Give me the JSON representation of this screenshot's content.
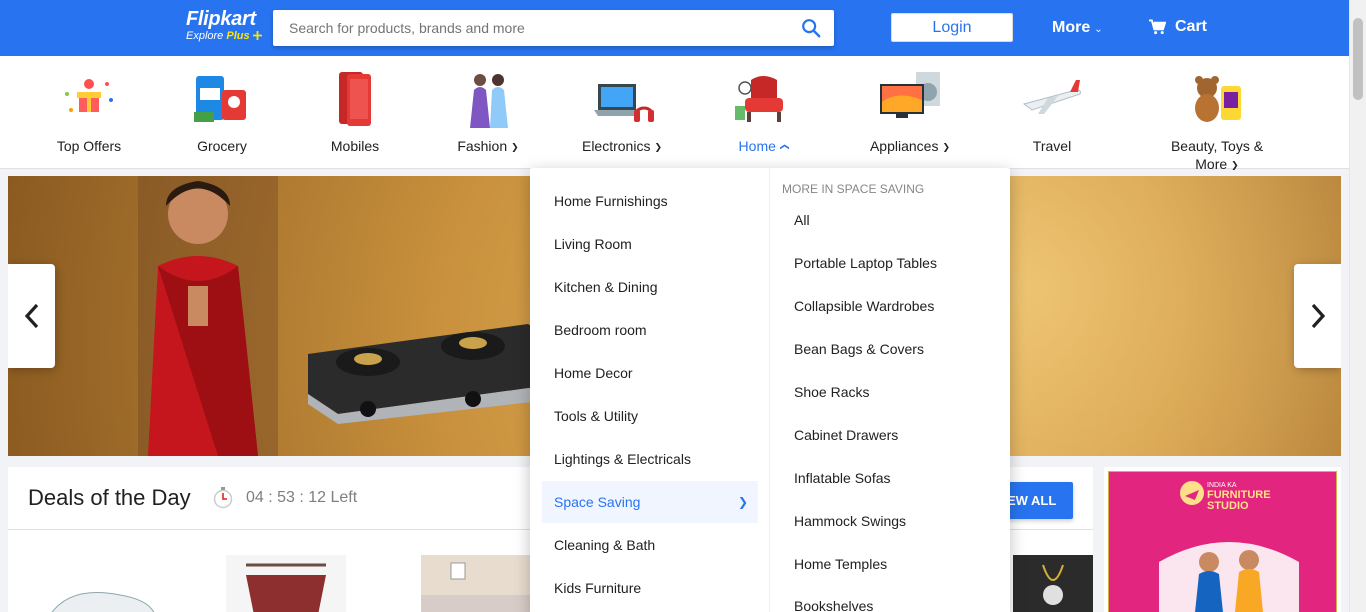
{
  "header": {
    "logo_text": "Flipkart",
    "logo_sub": "Explore",
    "logo_plus": "Plus",
    "search_placeholder": "Search for products, brands and more",
    "login_label": "Login",
    "more_label": "More",
    "cart_label": "Cart"
  },
  "colors": {
    "brand_blue": "#2874f0",
    "plus_yellow": "#ffe500"
  },
  "categories": [
    {
      "label": "Top Offers",
      "icon": "gift-box-icon",
      "has_chevron": false
    },
    {
      "label": "Grocery",
      "icon": "grocery-icon",
      "has_chevron": false
    },
    {
      "label": "Mobiles",
      "icon": "mobile-phone-icon",
      "has_chevron": false
    },
    {
      "label": "Fashion",
      "icon": "fashion-models-icon",
      "has_chevron": true
    },
    {
      "label": "Electronics",
      "icon": "laptop-headphones-icon",
      "has_chevron": true
    },
    {
      "label": "Home",
      "icon": "armchair-icon",
      "has_chevron": true,
      "active": true
    },
    {
      "label": "Appliances",
      "icon": "tv-washer-icon",
      "has_chevron": true
    },
    {
      "label": "Travel",
      "icon": "airplane-icon",
      "has_chevron": false
    },
    {
      "label": "Beauty, Toys & More",
      "icon": "teddy-bear-icon",
      "has_chevron": true
    }
  ],
  "dropdown": {
    "menu_items": [
      "Home Furnishings",
      "Living Room",
      "Kitchen & Dining",
      "Bedroom room",
      "Home Decor",
      "Tools & Utility",
      "Lightings & Electricals",
      "Space Saving",
      "Cleaning & Bath",
      "Kids Furniture"
    ],
    "active_item": "Space Saving",
    "sub_heading": "MORE IN SPACE SAVING",
    "sub_items": [
      "All",
      "Portable Laptop Tables",
      "Collapsible Wardrobes",
      "Bean Bags & Covers",
      "Shoe Racks",
      "Cabinet Drawers",
      "Inflatable Sofas",
      "Hammock Swings",
      "Home Temples",
      "Bookshelves"
    ]
  },
  "deals": {
    "title": "Deals of the Day",
    "timer": "04 : 53 : 12 Left",
    "view_all": "VIEW ALL"
  },
  "promo": {
    "line1": "INDIA KA",
    "line2": "FURNITURE",
    "line3": "STUDIO"
  }
}
